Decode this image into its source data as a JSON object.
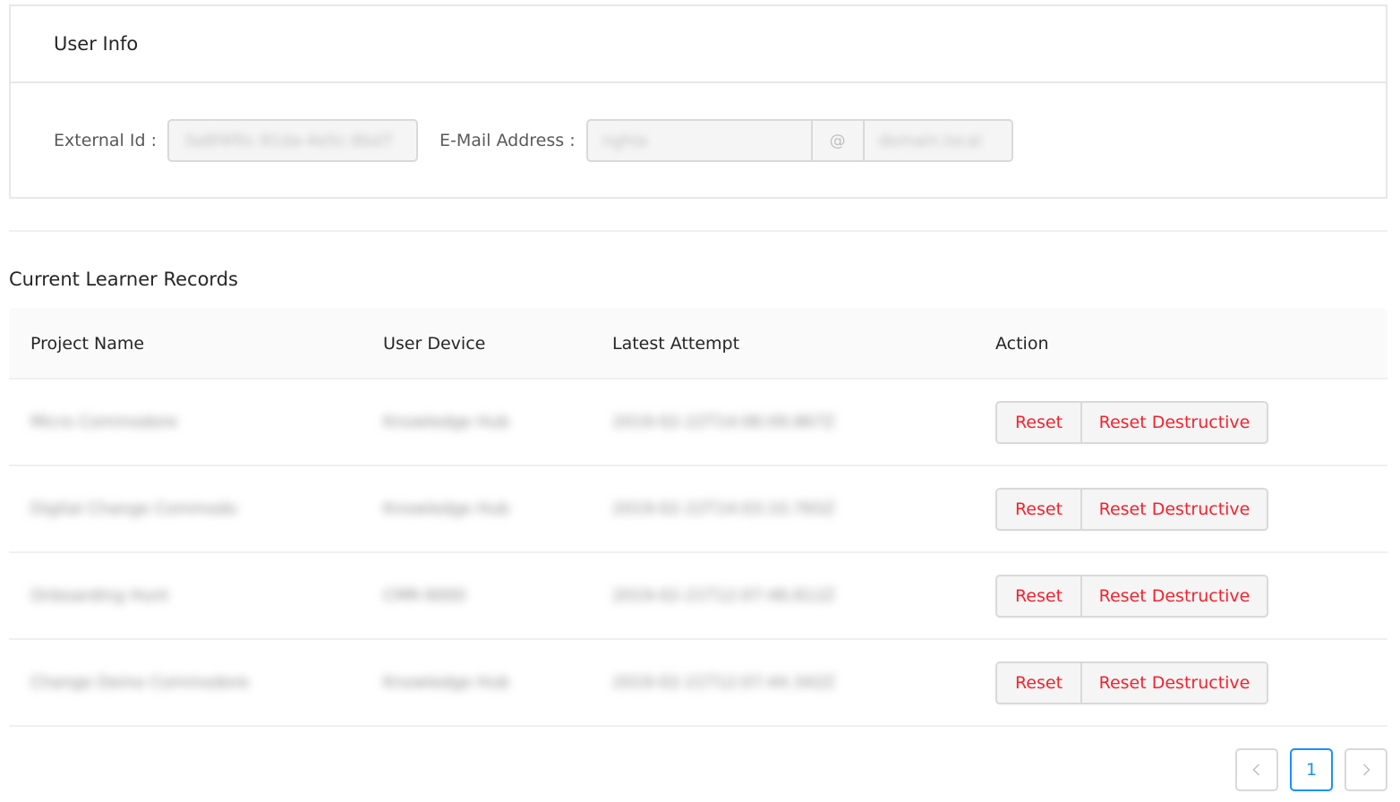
{
  "user_info": {
    "title": "User Info",
    "external_id_label": "External Id",
    "external_id_value": "3a8f4f0c-91da-4e5c-8bd7",
    "email_label": "E-Mail Address",
    "email_user": "nghia",
    "email_at": "@",
    "email_domain": "domain.local"
  },
  "records": {
    "title": "Current Learner Records",
    "columns": [
      "Project Name",
      "User Device",
      "Latest Attempt",
      "Action"
    ],
    "rows": [
      {
        "project": "Micro Commodore",
        "device": "Knowledge Hub",
        "attempt": "2019-02-22T14:06:09.867Z",
        "reset": "Reset",
        "reset_destructive": "Reset Destructive"
      },
      {
        "project": "Digital Change Commodo",
        "device": "Knowledge Hub",
        "attempt": "2019-02-22T14:03:10.765Z",
        "reset": "Reset",
        "reset_destructive": "Reset Destructive"
      },
      {
        "project": "Onboarding Hunt",
        "device": "CMR-9000",
        "attempt": "2019-02-21T12:07:48.812Z",
        "reset": "Reset",
        "reset_destructive": "Reset Destructive"
      },
      {
        "project": "Change Demo Commodore",
        "device": "Knowledge Hub",
        "attempt": "2019-02-21T12:07:44.342Z",
        "reset": "Reset",
        "reset_destructive": "Reset Destructive"
      }
    ]
  },
  "pagination": {
    "prev_icon": "chevron-left-icon",
    "current_page": "1",
    "next_icon": "chevron-right-icon"
  },
  "colors": {
    "danger": "#f5222d",
    "primary": "#1890ff"
  }
}
